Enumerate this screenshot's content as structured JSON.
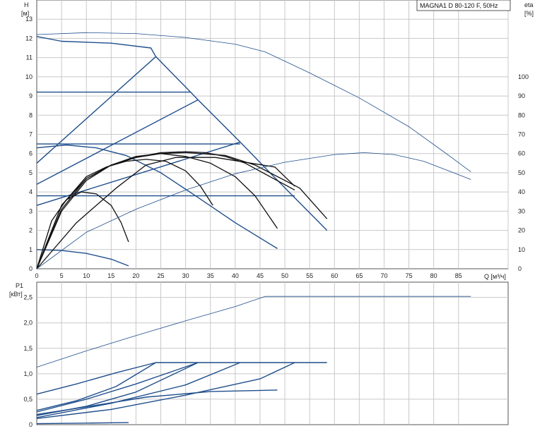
{
  "title": "MAGNA1 D 80-120 F, 50Hz",
  "colors": {
    "curve_blue": "#1f4e8c",
    "efficiency": "#111111",
    "grid": "#c8c8c8",
    "frame": "#555555"
  },
  "chart_data": [
    {
      "type": "line",
      "name": "head-and-efficiency",
      "xlabel": "Q [м³/ч]",
      "ylabel_left": "H",
      "ylabel_left_unit": "[м]",
      "ylabel_right": "eta",
      "ylabel_right_unit": "[%]",
      "xlim": [
        0,
        95
      ],
      "ylim_left": [
        0,
        14
      ],
      "ylim_right": [
        0,
        140
      ],
      "x_ticks": [
        0,
        5,
        10,
        15,
        20,
        25,
        30,
        35,
        40,
        45,
        50,
        55,
        60,
        65,
        70,
        75,
        80,
        85
      ],
      "y_left_ticks": [
        0,
        1,
        2,
        3,
        4,
        5,
        6,
        7,
        8,
        9,
        10,
        11,
        12,
        13
      ],
      "y_right_ticks": [
        0,
        10,
        20,
        30,
        40,
        50,
        60,
        70,
        80,
        90,
        100
      ],
      "grid": true,
      "legend_position": "top-right",
      "series": [
        {
          "axis": "left",
          "style": "thin",
          "points": [
            [
              0,
              12.2
            ],
            [
              10,
              12.3
            ],
            [
              20,
              12.25
            ],
            [
              30,
              12.05
            ],
            [
              40,
              11.7
            ],
            [
              46,
              11.3
            ],
            [
              55,
              10.2
            ],
            [
              65,
              8.9
            ],
            [
              75,
              7.4
            ],
            [
              82,
              6.1
            ],
            [
              87.5,
              5.05
            ]
          ]
        },
        {
          "axis": "left",
          "style": "blue",
          "points": [
            [
              0,
              12.1
            ],
            [
              5,
              11.85
            ],
            [
              15,
              11.75
            ],
            [
              23,
              11.5
            ],
            [
              24,
              11.05
            ]
          ]
        },
        {
          "axis": "left",
          "style": "blue",
          "points": [
            [
              24,
              11.05
            ],
            [
              31,
              9.2
            ],
            [
              32.5,
              8.8
            ],
            [
              41,
              6.6
            ],
            [
              47,
              5.0
            ],
            [
              58.5,
              2.0
            ]
          ]
        },
        {
          "axis": "left",
          "style": "blue",
          "points": [
            [
              0,
              9.2
            ],
            [
              31,
              9.2
            ]
          ]
        },
        {
          "axis": "left",
          "style": "blue",
          "points": [
            [
              0,
              6.5
            ],
            [
              41,
              6.5
            ]
          ]
        },
        {
          "axis": "left",
          "style": "blue",
          "points": [
            [
              0,
              3.8
            ],
            [
              52,
              3.8
            ]
          ]
        },
        {
          "axis": "left",
          "style": "blue",
          "points": [
            [
              0,
              5.5
            ],
            [
              24,
              11.05
            ]
          ]
        },
        {
          "axis": "left",
          "style": "blue",
          "points": [
            [
              0,
              4.4
            ],
            [
              32.5,
              8.8
            ]
          ]
        },
        {
          "axis": "left",
          "style": "blue",
          "points": [
            [
              0,
              3.3
            ],
            [
              41,
              6.6
            ]
          ]
        },
        {
          "axis": "left",
          "style": "blue",
          "points": [
            [
              0,
              6.3
            ],
            [
              6,
              6.45
            ],
            [
              12,
              6.3
            ],
            [
              18,
              5.9
            ],
            [
              25,
              5.0
            ],
            [
              32,
              3.8
            ],
            [
              40,
              2.4
            ],
            [
              48.5,
              1.05
            ]
          ]
        },
        {
          "axis": "left",
          "style": "blue",
          "points": [
            [
              0,
              1.0
            ],
            [
              5,
              0.95
            ],
            [
              10,
              0.8
            ],
            [
              15,
              0.5
            ],
            [
              18.5,
              0.15
            ]
          ]
        },
        {
          "axis": "left",
          "style": "black",
          "points": [
            [
              0,
              0
            ],
            [
              5,
              3.3
            ],
            [
              10,
              4.7
            ],
            [
              15,
              5.4
            ],
            [
              20,
              5.8
            ],
            [
              25,
              6.0
            ],
            [
              30,
              6.05
            ],
            [
              33,
              6.0
            ],
            [
              38,
              5.9
            ],
            [
              44,
              5.4
            ],
            [
              50,
              4.6
            ],
            [
              53,
              4.2
            ],
            [
              58.5,
              2.6
            ]
          ]
        },
        {
          "axis": "left",
          "style": "black",
          "points": [
            [
              0,
              0
            ],
            [
              5,
              3.0
            ],
            [
              10,
              4.6
            ],
            [
              15,
              5.4
            ],
            [
              20,
              5.8
            ],
            [
              25,
              6.05
            ],
            [
              30,
              6.1
            ],
            [
              34,
              6.05
            ],
            [
              38,
              5.85
            ],
            [
              42,
              5.5
            ],
            [
              47,
              4.8
            ],
            [
              52,
              4.1
            ]
          ]
        },
        {
          "axis": "left",
          "style": "black",
          "points": [
            [
              0,
              0
            ],
            [
              5,
              3.1
            ],
            [
              10,
              4.7
            ],
            [
              15,
              5.4
            ],
            [
              20,
              5.85
            ],
            [
              25,
              6.0
            ],
            [
              30,
              5.85
            ],
            [
              35,
              5.5
            ],
            [
              40,
              4.8
            ],
            [
              44,
              3.8
            ],
            [
              48.5,
              2.1
            ]
          ]
        },
        {
          "axis": "left",
          "style": "black",
          "points": [
            [
              0,
              0
            ],
            [
              5,
              3.3
            ],
            [
              10,
              4.8
            ],
            [
              14,
              5.3
            ],
            [
              18,
              5.6
            ],
            [
              22,
              5.7
            ],
            [
              26,
              5.6
            ],
            [
              30,
              5.1
            ],
            [
              33,
              4.3
            ],
            [
              35.5,
              3.3
            ]
          ]
        },
        {
          "axis": "left",
          "style": "black",
          "points": [
            [
              0,
              0
            ],
            [
              3,
              2.5
            ],
            [
              6,
              3.6
            ],
            [
              9,
              4.0
            ],
            [
              12,
              3.9
            ],
            [
              15,
              3.3
            ],
            [
              17,
              2.4
            ],
            [
              18.5,
              1.4
            ]
          ]
        },
        {
          "axis": "left",
          "style": "black",
          "points": [
            [
              0,
              0
            ],
            [
              8,
              2.4
            ],
            [
              16,
              4.2
            ],
            [
              22,
              5.4
            ],
            [
              28,
              5.8
            ],
            [
              36,
              5.8
            ],
            [
              48,
              5.3
            ],
            [
              52,
              4.3
            ]
          ]
        },
        {
          "axis": "right",
          "style": "thin",
          "points": [
            [
              0,
              0
            ],
            [
              10,
              19
            ],
            [
              20,
              31
            ],
            [
              30,
              41
            ],
            [
              40,
              49.5
            ],
            [
              50,
              55.5
            ],
            [
              60,
              59.5
            ],
            [
              66,
              60.5
            ],
            [
              72,
              59.5
            ],
            [
              78,
              56
            ],
            [
              84,
              50
            ],
            [
              87.5,
              46.5
            ]
          ]
        }
      ]
    },
    {
      "type": "line",
      "name": "power",
      "ylabel": "P1",
      "ylabel_unit": "[кВт]",
      "xlim": [
        0,
        95
      ],
      "ylim": [
        0,
        2.8
      ],
      "y_ticks": [
        0,
        0.5,
        1.0,
        1.5,
        2.0,
        2.5
      ],
      "y_tick_labels": [
        "0",
        "0,5",
        "1,0",
        "1,5",
        "2,0",
        "2,5"
      ],
      "grid": true,
      "series": [
        {
          "style": "thin",
          "points": [
            [
              0,
              1.13
            ],
            [
              10,
              1.45
            ],
            [
              20,
              1.75
            ],
            [
              30,
              2.04
            ],
            [
              40,
              2.32
            ],
            [
              46,
              2.52
            ],
            [
              60,
              2.52
            ],
            [
              75,
              2.52
            ],
            [
              87.5,
              2.52
            ]
          ]
        },
        {
          "style": "blue",
          "points": [
            [
              0,
              0.6
            ],
            [
              8,
              0.8
            ],
            [
              16,
              1.02
            ],
            [
              24,
              1.22
            ],
            [
              58.5,
              1.22
            ]
          ]
        },
        {
          "style": "blue",
          "points": [
            [
              0,
              0.28
            ],
            [
              8,
              0.47
            ],
            [
              16,
              0.75
            ],
            [
              24,
              1.22
            ]
          ]
        },
        {
          "style": "blue",
          "points": [
            [
              0,
              0.18
            ],
            [
              10,
              0.36
            ],
            [
              20,
              0.64
            ],
            [
              32.5,
              1.22
            ]
          ]
        },
        {
          "style": "blue",
          "points": [
            [
              0,
              0.25
            ],
            [
              10,
              0.5
            ],
            [
              20,
              0.8
            ],
            [
              32.5,
              1.22
            ]
          ]
        },
        {
          "style": "blue",
          "points": [
            [
              0,
              0.14
            ],
            [
              15,
              0.42
            ],
            [
              30,
              0.78
            ],
            [
              41,
              1.22
            ]
          ]
        },
        {
          "style": "blue",
          "points": [
            [
              0,
              0.12
            ],
            [
              15,
              0.3
            ],
            [
              30,
              0.58
            ],
            [
              45,
              0.9
            ],
            [
              52,
              1.22
            ]
          ]
        },
        {
          "style": "blue",
          "points": [
            [
              0,
              0.2
            ],
            [
              10,
              0.35
            ],
            [
              22,
              0.54
            ],
            [
              35,
              0.65
            ],
            [
              48.5,
              0.68
            ]
          ]
        },
        {
          "style": "blue",
          "points": [
            [
              0,
              0.02
            ],
            [
              10,
              0.03
            ],
            [
              18.5,
              0.04
            ]
          ]
        }
      ]
    }
  ]
}
